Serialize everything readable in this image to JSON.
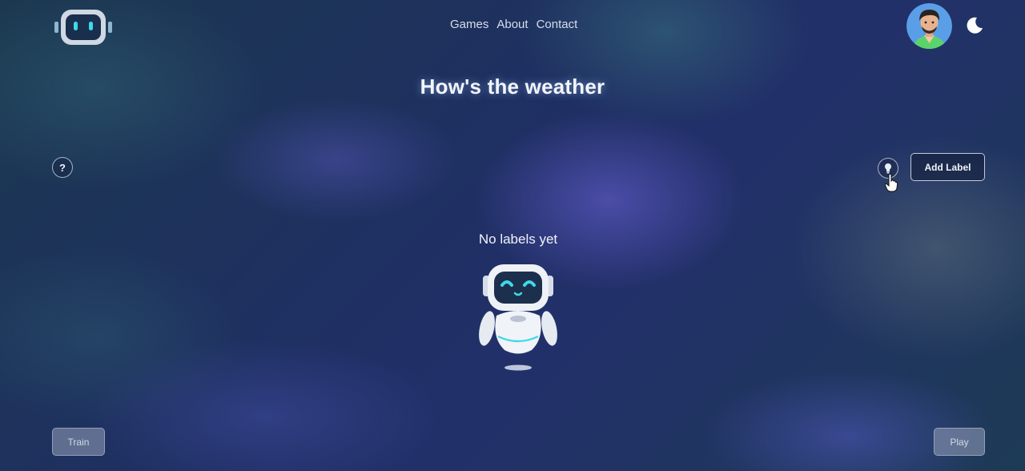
{
  "nav": {
    "links": [
      "Games",
      "About",
      "Contact"
    ]
  },
  "header": {
    "logo_icon": "robot-head-icon",
    "theme_toggle_icon": "moon-icon",
    "avatar_icon": "user-avatar"
  },
  "page": {
    "title": "How's the weather"
  },
  "toolbar": {
    "help_label": "?",
    "hint_icon": "lightbulb-icon",
    "add_label": "Add Label"
  },
  "empty_state": {
    "message": "No labels yet",
    "illustration": "robot-mascot"
  },
  "footer": {
    "train_label": "Train",
    "play_label": "Play"
  },
  "colors": {
    "accent_cyan": "#3fd8e8",
    "background_dark": "#1f2f63"
  }
}
